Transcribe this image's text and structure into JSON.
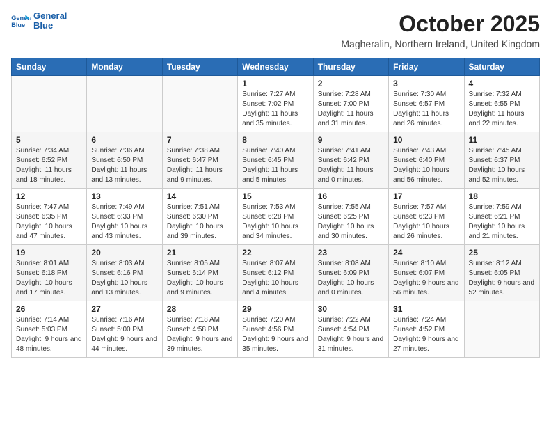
{
  "header": {
    "logo_line1": "General",
    "logo_line2": "Blue",
    "month": "October 2025",
    "location": "Magheralin, Northern Ireland, United Kingdom"
  },
  "days_of_week": [
    "Sunday",
    "Monday",
    "Tuesday",
    "Wednesday",
    "Thursday",
    "Friday",
    "Saturday"
  ],
  "weeks": [
    [
      {
        "day": "",
        "details": ""
      },
      {
        "day": "",
        "details": ""
      },
      {
        "day": "",
        "details": ""
      },
      {
        "day": "1",
        "details": "Sunrise: 7:27 AM\nSunset: 7:02 PM\nDaylight: 11 hours and 35 minutes."
      },
      {
        "day": "2",
        "details": "Sunrise: 7:28 AM\nSunset: 7:00 PM\nDaylight: 11 hours and 31 minutes."
      },
      {
        "day": "3",
        "details": "Sunrise: 7:30 AM\nSunset: 6:57 PM\nDaylight: 11 hours and 26 minutes."
      },
      {
        "day": "4",
        "details": "Sunrise: 7:32 AM\nSunset: 6:55 PM\nDaylight: 11 hours and 22 minutes."
      }
    ],
    [
      {
        "day": "5",
        "details": "Sunrise: 7:34 AM\nSunset: 6:52 PM\nDaylight: 11 hours and 18 minutes."
      },
      {
        "day": "6",
        "details": "Sunrise: 7:36 AM\nSunset: 6:50 PM\nDaylight: 11 hours and 13 minutes."
      },
      {
        "day": "7",
        "details": "Sunrise: 7:38 AM\nSunset: 6:47 PM\nDaylight: 11 hours and 9 minutes."
      },
      {
        "day": "8",
        "details": "Sunrise: 7:40 AM\nSunset: 6:45 PM\nDaylight: 11 hours and 5 minutes."
      },
      {
        "day": "9",
        "details": "Sunrise: 7:41 AM\nSunset: 6:42 PM\nDaylight: 11 hours and 0 minutes."
      },
      {
        "day": "10",
        "details": "Sunrise: 7:43 AM\nSunset: 6:40 PM\nDaylight: 10 hours and 56 minutes."
      },
      {
        "day": "11",
        "details": "Sunrise: 7:45 AM\nSunset: 6:37 PM\nDaylight: 10 hours and 52 minutes."
      }
    ],
    [
      {
        "day": "12",
        "details": "Sunrise: 7:47 AM\nSunset: 6:35 PM\nDaylight: 10 hours and 47 minutes."
      },
      {
        "day": "13",
        "details": "Sunrise: 7:49 AM\nSunset: 6:33 PM\nDaylight: 10 hours and 43 minutes."
      },
      {
        "day": "14",
        "details": "Sunrise: 7:51 AM\nSunset: 6:30 PM\nDaylight: 10 hours and 39 minutes."
      },
      {
        "day": "15",
        "details": "Sunrise: 7:53 AM\nSunset: 6:28 PM\nDaylight: 10 hours and 34 minutes."
      },
      {
        "day": "16",
        "details": "Sunrise: 7:55 AM\nSunset: 6:25 PM\nDaylight: 10 hours and 30 minutes."
      },
      {
        "day": "17",
        "details": "Sunrise: 7:57 AM\nSunset: 6:23 PM\nDaylight: 10 hours and 26 minutes."
      },
      {
        "day": "18",
        "details": "Sunrise: 7:59 AM\nSunset: 6:21 PM\nDaylight: 10 hours and 21 minutes."
      }
    ],
    [
      {
        "day": "19",
        "details": "Sunrise: 8:01 AM\nSunset: 6:18 PM\nDaylight: 10 hours and 17 minutes."
      },
      {
        "day": "20",
        "details": "Sunrise: 8:03 AM\nSunset: 6:16 PM\nDaylight: 10 hours and 13 minutes."
      },
      {
        "day": "21",
        "details": "Sunrise: 8:05 AM\nSunset: 6:14 PM\nDaylight: 10 hours and 9 minutes."
      },
      {
        "day": "22",
        "details": "Sunrise: 8:07 AM\nSunset: 6:12 PM\nDaylight: 10 hours and 4 minutes."
      },
      {
        "day": "23",
        "details": "Sunrise: 8:08 AM\nSunset: 6:09 PM\nDaylight: 10 hours and 0 minutes."
      },
      {
        "day": "24",
        "details": "Sunrise: 8:10 AM\nSunset: 6:07 PM\nDaylight: 9 hours and 56 minutes."
      },
      {
        "day": "25",
        "details": "Sunrise: 8:12 AM\nSunset: 6:05 PM\nDaylight: 9 hours and 52 minutes."
      }
    ],
    [
      {
        "day": "26",
        "details": "Sunrise: 7:14 AM\nSunset: 5:03 PM\nDaylight: 9 hours and 48 minutes."
      },
      {
        "day": "27",
        "details": "Sunrise: 7:16 AM\nSunset: 5:00 PM\nDaylight: 9 hours and 44 minutes."
      },
      {
        "day": "28",
        "details": "Sunrise: 7:18 AM\nSunset: 4:58 PM\nDaylight: 9 hours and 39 minutes."
      },
      {
        "day": "29",
        "details": "Sunrise: 7:20 AM\nSunset: 4:56 PM\nDaylight: 9 hours and 35 minutes."
      },
      {
        "day": "30",
        "details": "Sunrise: 7:22 AM\nSunset: 4:54 PM\nDaylight: 9 hours and 31 minutes."
      },
      {
        "day": "31",
        "details": "Sunrise: 7:24 AM\nSunset: 4:52 PM\nDaylight: 9 hours and 27 minutes."
      },
      {
        "day": "",
        "details": ""
      }
    ]
  ]
}
